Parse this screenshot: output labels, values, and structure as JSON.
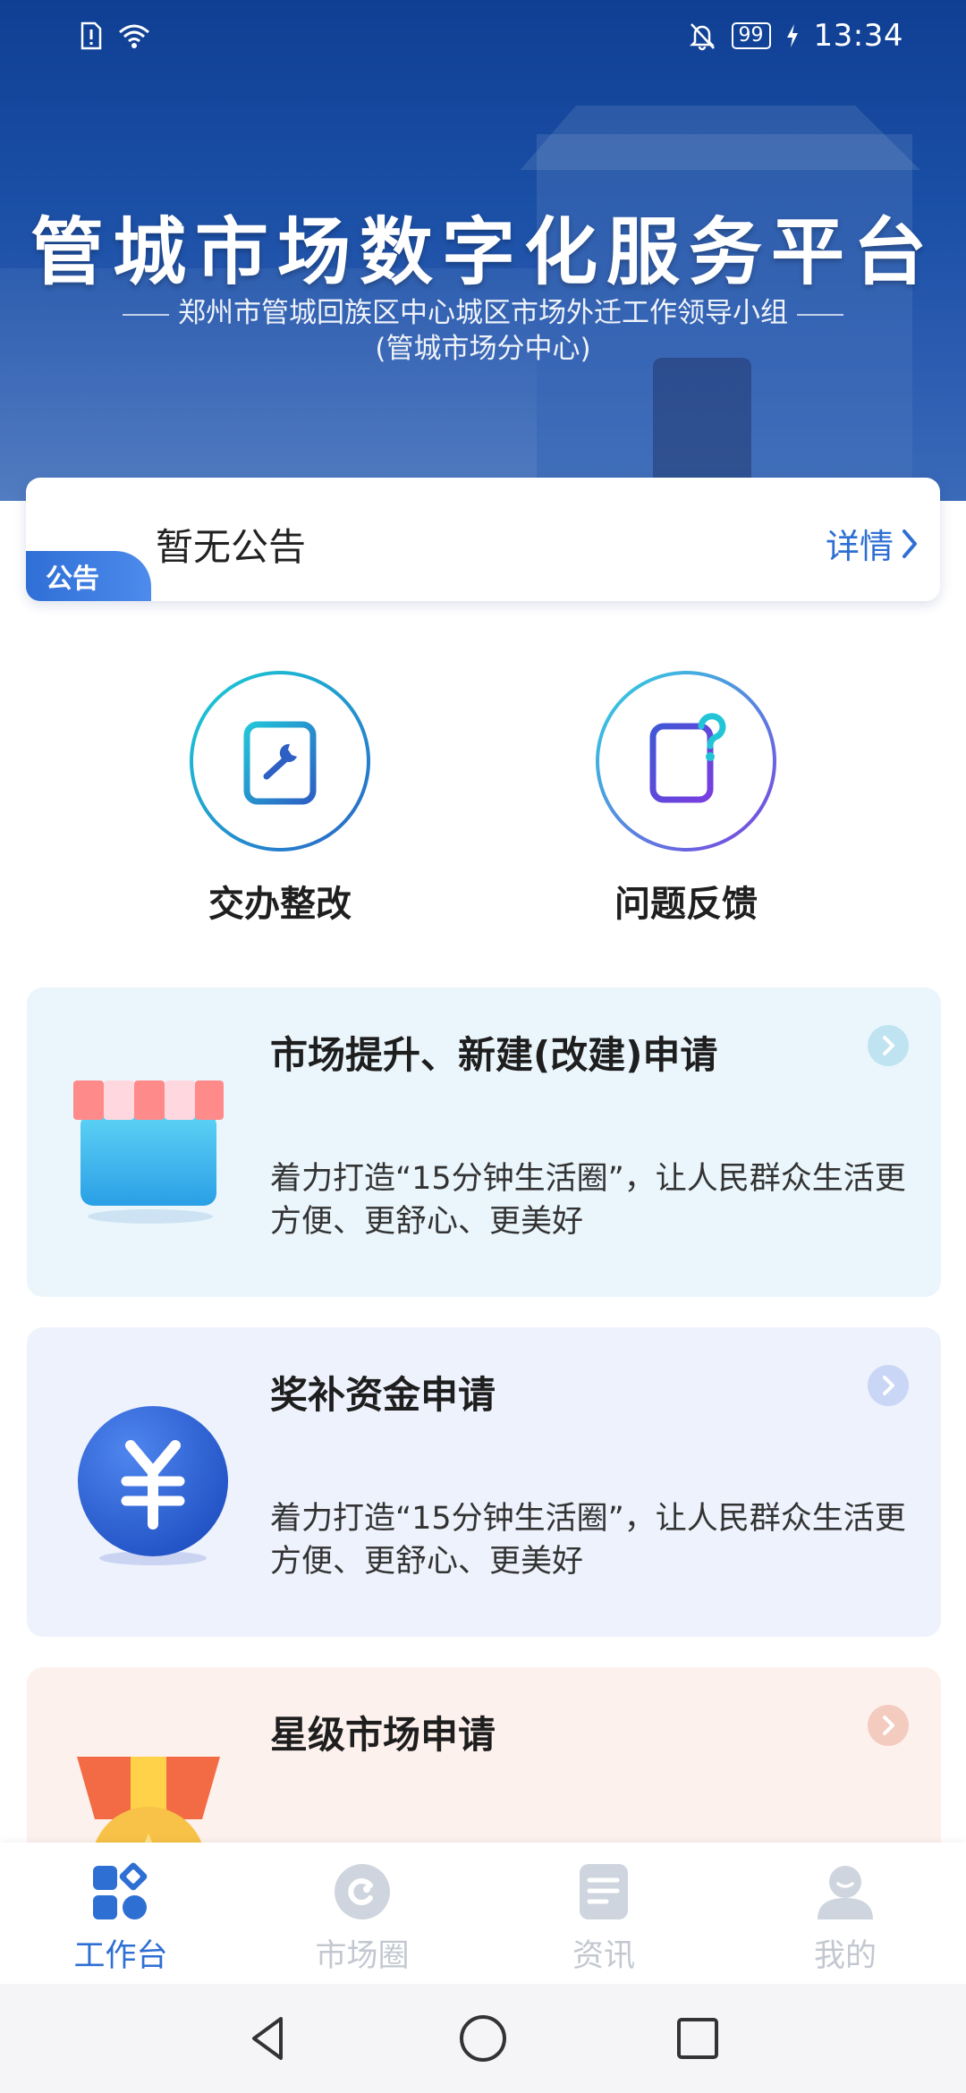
{
  "status_bar": {
    "battery": "99",
    "time": "13:34"
  },
  "hero": {
    "title": "管城市场数字化服务平台",
    "subtitle_line1": "郑州市管城回族区中心城区市场外迁工作领导小组",
    "subtitle_line2": "(管城市场分中心)"
  },
  "notice": {
    "badge": "公告",
    "text": "暂无公告",
    "detail_label": "详情"
  },
  "shortcuts": [
    {
      "label": "交办整改",
      "icon": "clipboard-wrench-icon"
    },
    {
      "label": "问题反馈",
      "icon": "document-question-icon"
    }
  ],
  "cards": [
    {
      "title": "市场提升、新建(改建)申请",
      "desc": "着力打造“15分钟生活圈”，让人民群众生活更方便、更舒心、更美好",
      "icon": "shop-awning-icon",
      "color": "#eaf6fc"
    },
    {
      "title": "奖补资金申请",
      "desc": "着力打造“15分钟生活圈”，让人民群众生活更方便、更舒心、更美好",
      "icon": "yuan-coin-icon",
      "color": "#eef2fc"
    },
    {
      "title": "星级市场申请",
      "icon": "medal-star-icon",
      "color": "#fdf1ed"
    }
  ],
  "tabbar": {
    "active_color": "#2e6fd3",
    "items": [
      {
        "label": "工作台",
        "icon": "workbench-icon",
        "active": true
      },
      {
        "label": "市场圈",
        "icon": "market-circle-icon",
        "active": false
      },
      {
        "label": "资讯",
        "icon": "news-icon",
        "active": false
      },
      {
        "label": "我的",
        "icon": "profile-icon",
        "active": false
      }
    ]
  },
  "navbar": {
    "buttons": [
      "back-icon",
      "home-icon",
      "recents-icon"
    ]
  }
}
